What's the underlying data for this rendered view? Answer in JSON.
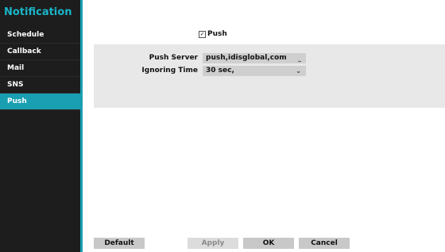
{
  "sidebar": {
    "title": "Notification",
    "items": [
      {
        "label": "Schedule"
      },
      {
        "label": "Callback"
      },
      {
        "label": "Mail"
      },
      {
        "label": "SNS"
      },
      {
        "label": "Push",
        "active": true
      }
    ]
  },
  "push": {
    "checkbox_label": "Push",
    "checked": true,
    "server_label": "Push Server",
    "server_value": "push,idisglobal,com",
    "ignoring_label": "Ignoring Time",
    "ignoring_value": "30 sec,"
  },
  "buttons": {
    "default": "Default",
    "apply": "Apply",
    "ok": "OK",
    "cancel": "Cancel"
  },
  "colors": {
    "accent": "#1a9fb2",
    "sidebar_bg": "#1d1d1d"
  }
}
